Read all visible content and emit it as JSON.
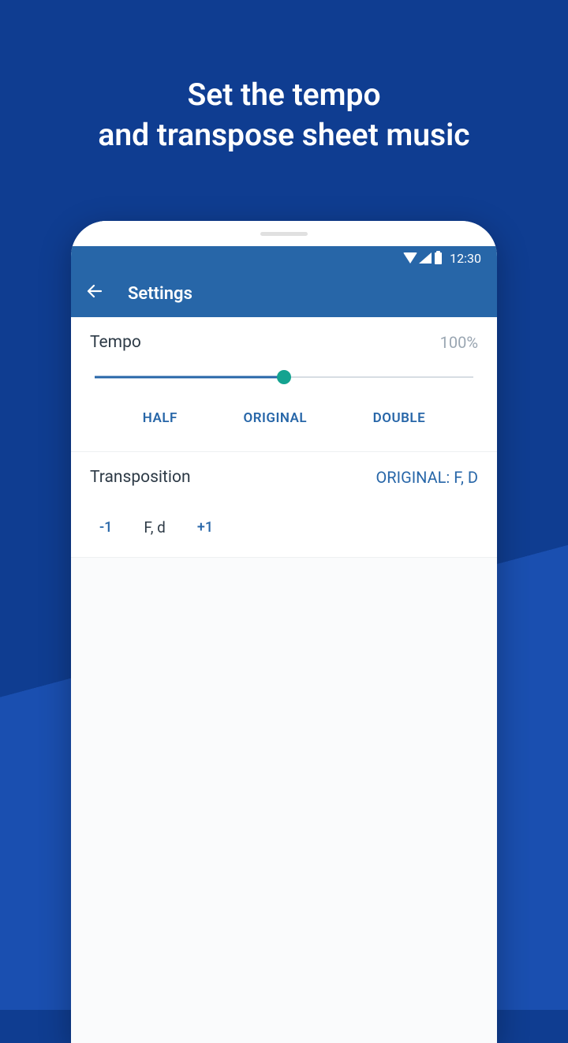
{
  "marketing": {
    "line1": "Set the tempo",
    "line2": "and transpose sheet music"
  },
  "status": {
    "time": "12:30"
  },
  "appbar": {
    "title": "Settings"
  },
  "tempo": {
    "label": "Tempo",
    "value": "100%",
    "preset_half": "HALF",
    "preset_original": "ORIGINAL",
    "preset_double": "DOUBLE",
    "slider_percent": 50
  },
  "transposition": {
    "label": "Transposition",
    "original_label": "ORIGINAL: F, D",
    "btn_down": "-1",
    "current_key": "F, d",
    "btn_up": "+1"
  }
}
